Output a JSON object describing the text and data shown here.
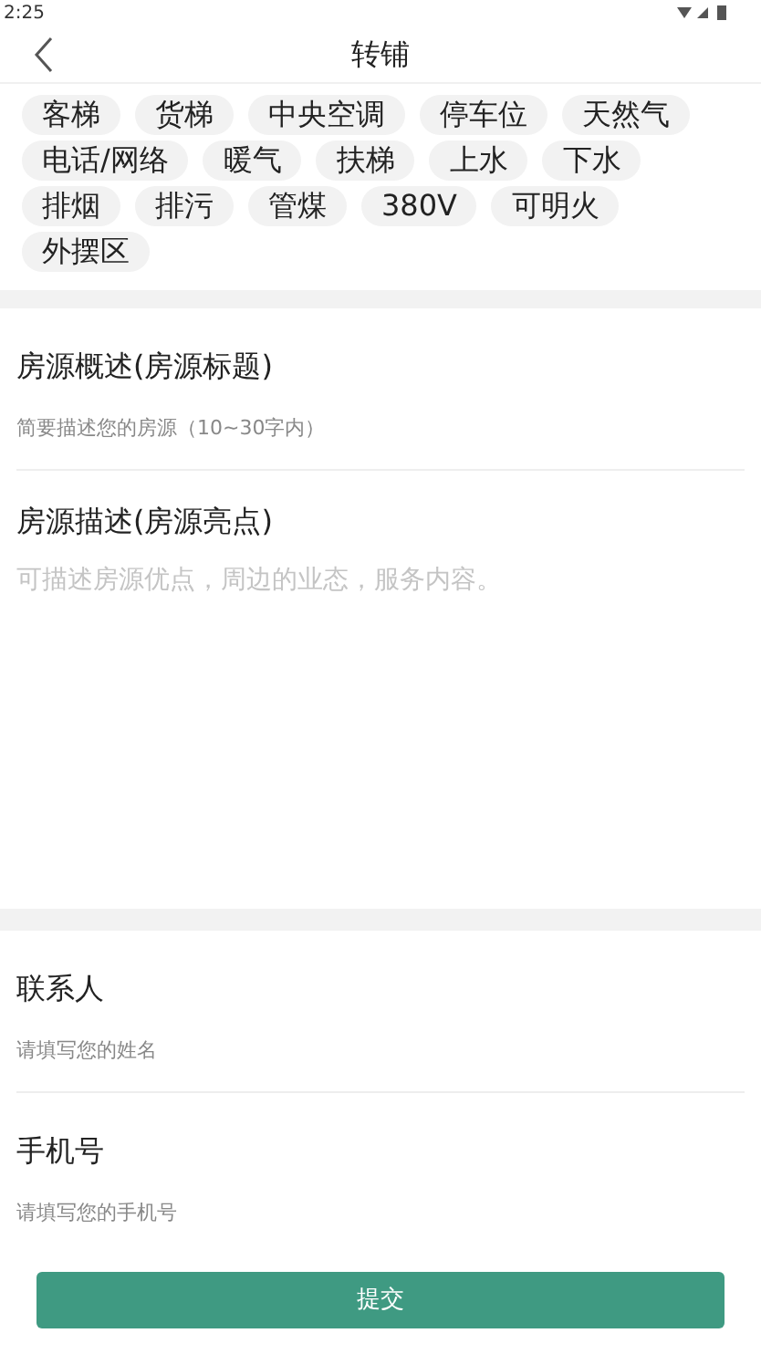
{
  "status_bar": {
    "time": "2:25"
  },
  "header": {
    "title": "转铺"
  },
  "tags": [
    {
      "label": "客梯"
    },
    {
      "label": "货梯"
    },
    {
      "label": "中央空调"
    },
    {
      "label": "停车位"
    },
    {
      "label": "天然气"
    },
    {
      "label": "电话/网络"
    },
    {
      "label": "暖气"
    },
    {
      "label": "扶梯"
    },
    {
      "label": "上水"
    },
    {
      "label": "下水"
    },
    {
      "label": "排烟"
    },
    {
      "label": "排污"
    },
    {
      "label": "管煤"
    },
    {
      "label": "380V"
    },
    {
      "label": "可明火"
    },
    {
      "label": "外摆区"
    }
  ],
  "summary": {
    "label": "房源概述(房源标题)",
    "placeholder": "简要描述您的房源（10~30字内）"
  },
  "description": {
    "label": "房源描述(房源亮点)",
    "placeholder": "可描述房源优点，周边的业态，服务内容。"
  },
  "contact": {
    "label": "联系人",
    "placeholder": "请填写您的姓名"
  },
  "phone": {
    "label": "手机号",
    "placeholder": "请填写您的手机号"
  },
  "submit": {
    "label": "提交"
  }
}
